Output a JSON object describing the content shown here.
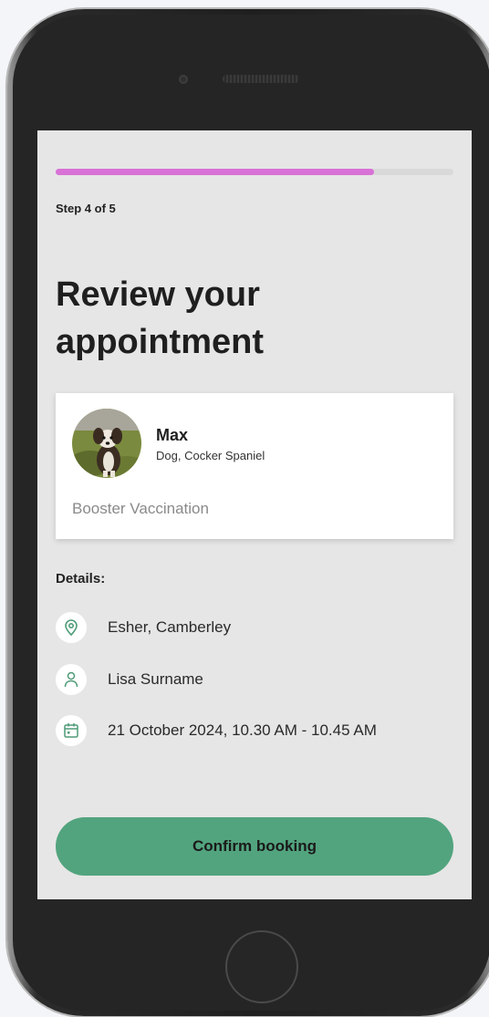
{
  "progress": {
    "fraction": 0.8
  },
  "step_label": "Step 4 of 5",
  "title": "Review your appointment",
  "pet": {
    "name": "Max",
    "breed": "Dog, Cocker Spaniel",
    "service": "Booster Vaccination"
  },
  "details": {
    "label": "Details:",
    "location": "Esher, Camberley",
    "vet": "Lisa Surname",
    "datetime": "21 October 2024, 10.30 AM - 10.45 AM"
  },
  "confirm_label": "Confirm booking",
  "colors": {
    "accent_progress": "#d872d6",
    "button_green": "#52a47e",
    "icon_green": "#4f9c78"
  },
  "icons": [
    "location-pin-icon",
    "person-icon",
    "calendar-icon"
  ]
}
